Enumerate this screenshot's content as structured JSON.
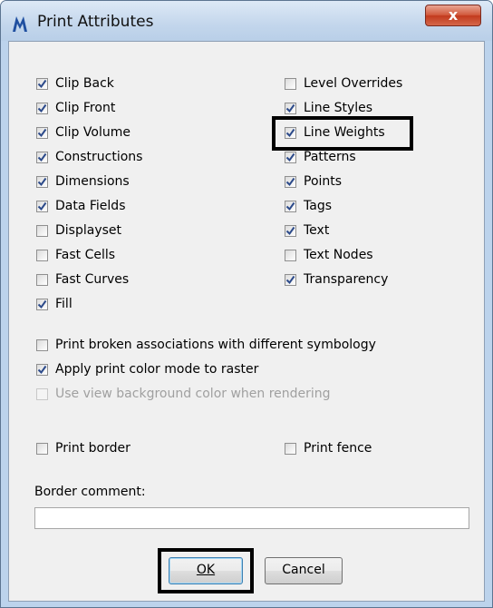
{
  "window": {
    "title": "Print Attributes",
    "close_symbol": "x"
  },
  "left_column": [
    {
      "label": "Clip Back",
      "checked": true
    },
    {
      "label": "Clip Front",
      "checked": true
    },
    {
      "label": "Clip Volume",
      "checked": true
    },
    {
      "label": "Constructions",
      "checked": true
    },
    {
      "label": "Dimensions",
      "checked": true
    },
    {
      "label": "Data Fields",
      "checked": true
    },
    {
      "label": "Displayset",
      "checked": false
    },
    {
      "label": "Fast Cells",
      "checked": false
    },
    {
      "label": "Fast Curves",
      "checked": false
    },
    {
      "label": "Fill",
      "checked": true
    }
  ],
  "right_column": [
    {
      "label": "Level Overrides",
      "checked": false
    },
    {
      "label": "Line Styles",
      "checked": true
    },
    {
      "label": "Line Weights",
      "checked": true
    },
    {
      "label": "Patterns",
      "checked": true
    },
    {
      "label": "Points",
      "checked": true
    },
    {
      "label": "Tags",
      "checked": true
    },
    {
      "label": "Text",
      "checked": true
    },
    {
      "label": "Text Nodes",
      "checked": false
    },
    {
      "label": "Transparency",
      "checked": true
    }
  ],
  "options": [
    {
      "label": "Print broken associations with different symbology",
      "checked": false,
      "disabled": false
    },
    {
      "label": "Apply print color mode to raster",
      "checked": true,
      "disabled": false
    },
    {
      "label": "Use view background color when rendering",
      "checked": false,
      "disabled": true
    }
  ],
  "print_border": {
    "label": "Print border",
    "checked": false
  },
  "print_fence": {
    "label": "Print fence",
    "checked": false
  },
  "border_comment": {
    "label": "Border comment:",
    "value": ""
  },
  "buttons": {
    "ok": "OK",
    "cancel": "Cancel"
  },
  "colors": {
    "title_bar": "#c3d6ec",
    "client": "#f0f0f0",
    "close_button": "#c9432a",
    "check": "#2c4a8a"
  }
}
